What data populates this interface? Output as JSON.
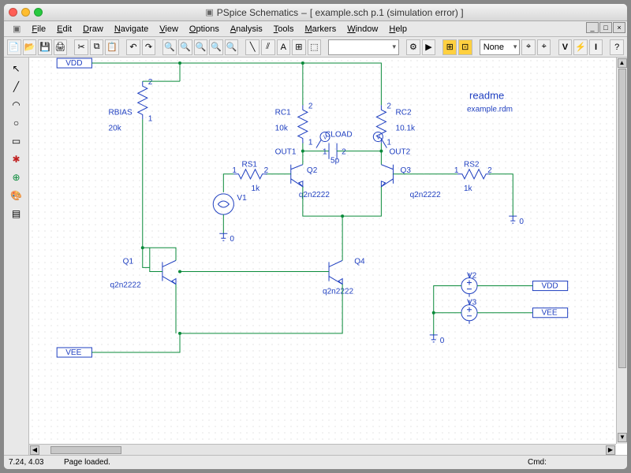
{
  "window": {
    "app_name": "PSpice Schematics",
    "doc_title": "[ example.sch  p.1 (simulation error)  ]"
  },
  "menu": {
    "items": [
      "File",
      "Edit",
      "Draw",
      "Navigate",
      "View",
      "Options",
      "Analysis",
      "Tools",
      "Markers",
      "Window",
      "Help"
    ]
  },
  "toolbar": {
    "part_selector": "",
    "layer_selector": "None"
  },
  "status": {
    "coord": "7.24,  4.03",
    "message": "Page loaded.",
    "cmd_label": "Cmd:"
  },
  "schematic": {
    "readme_title": "readme",
    "readme_file": "example.rdm",
    "ports": {
      "vdd_top": "VDD",
      "vee_bottom": "VEE",
      "vdd_right": "VDD",
      "vee_right": "VEE"
    },
    "labels": {
      "rbias_name": "RBIAS",
      "rbias_val": "20k",
      "rc1_name": "RC1",
      "rc1_val": "10k",
      "rc2_name": "RC2",
      "rc2_val": "10.1k",
      "rs1_name": "RS1",
      "rs1_val": "1k",
      "rs2_name": "RS2",
      "rs2_val": "1k",
      "cload_name": "CLOAD",
      "cload_val": "5p",
      "out1": "OUT1",
      "out2": "OUT2",
      "q1_name": "Q1",
      "q1_val": "q2n2222",
      "q2_name": "Q2",
      "q2_val": "q2n2222",
      "q3_name": "Q3",
      "q3_val": "q2n2222",
      "q4_name": "Q4",
      "q4_val": "q2n2222",
      "v1": "V1",
      "v2": "V2",
      "v3": "V3",
      "pin1": "1",
      "pin2": "2",
      "gnd0": "0"
    }
  }
}
